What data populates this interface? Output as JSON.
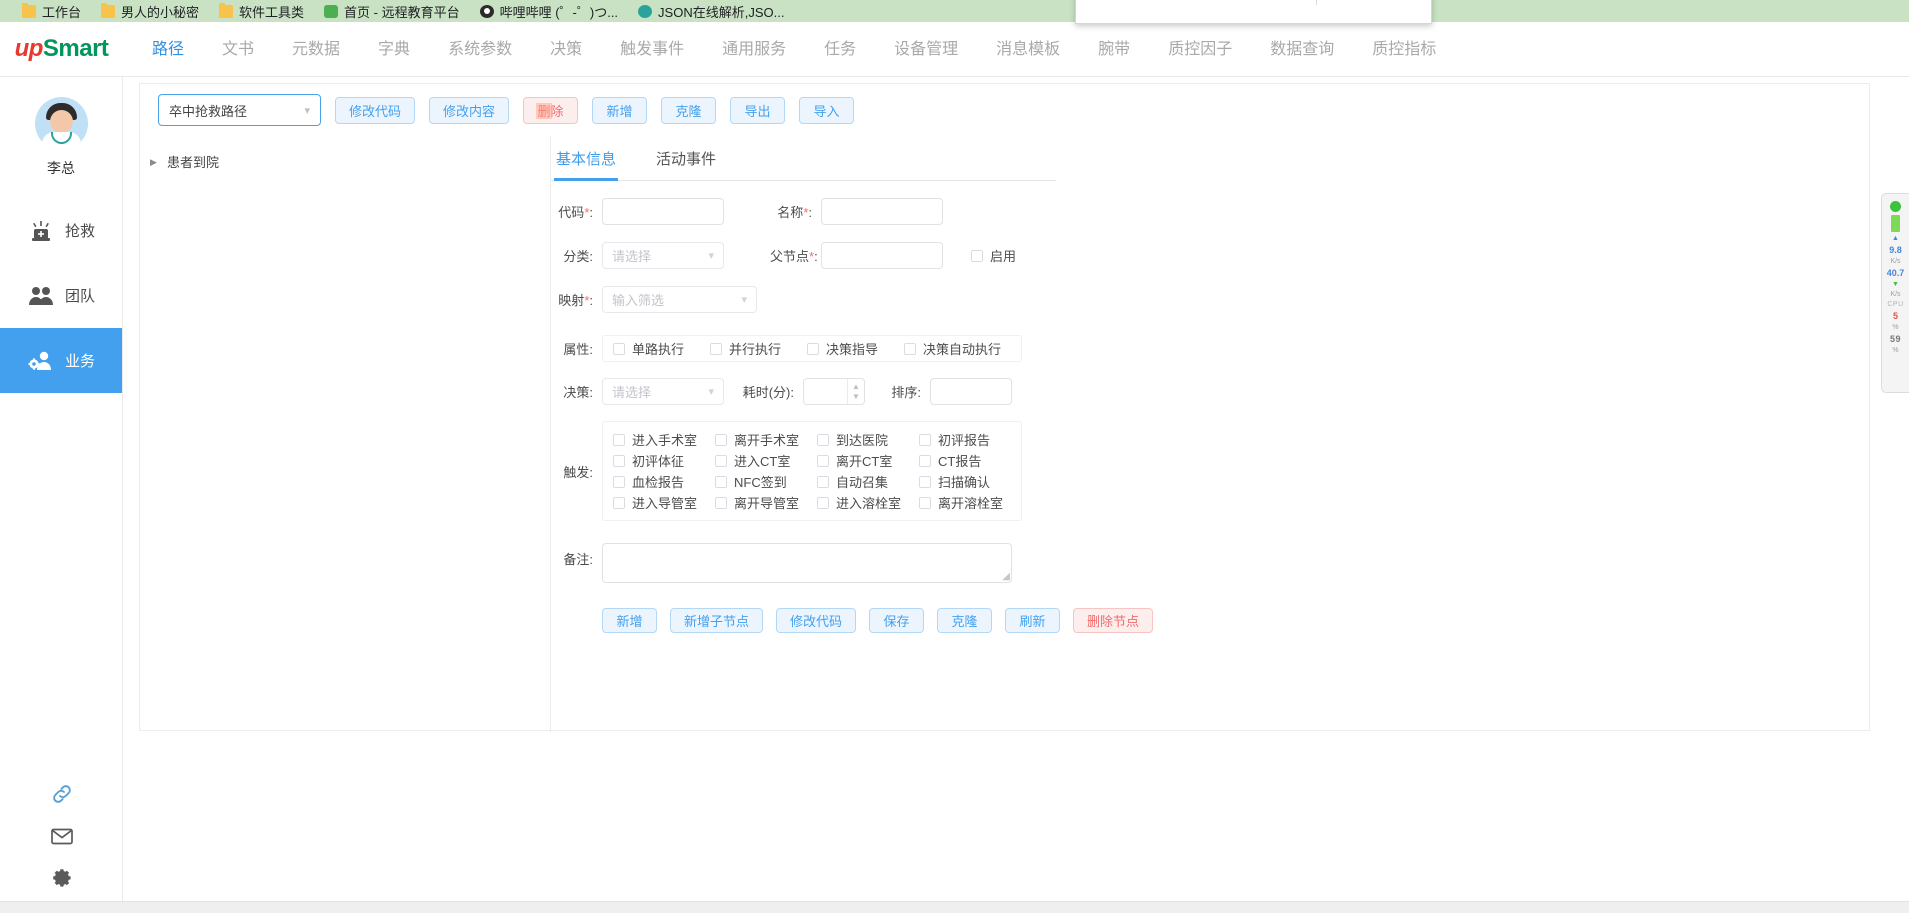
{
  "browser": {
    "bookmarks": [
      {
        "label": "工作台",
        "icon": "folder-icon"
      },
      {
        "label": "男人的小秘密",
        "icon": "folder-icon"
      },
      {
        "label": "软件工具类",
        "icon": "folder-icon"
      },
      {
        "label": "首页 - 远程教育平台",
        "icon": "green-site-icon"
      },
      {
        "label": "哔哩哔哩 (゜-゜)つ...",
        "icon": "bilibili-icon"
      },
      {
        "label": "JSON在线解析,JSO...",
        "icon": "json-site-icon"
      }
    ],
    "find_bar": {
      "value": "",
      "placeholder": "",
      "prev_label": "∧",
      "next_label": "∨",
      "close_label": "✕"
    }
  },
  "header": {
    "logo_up": "up",
    "logo_smart": "Smart",
    "nav": [
      {
        "label": "路径",
        "active": true
      },
      {
        "label": "文书",
        "active": false
      },
      {
        "label": "元数据",
        "active": false
      },
      {
        "label": "字典",
        "active": false
      },
      {
        "label": "系统参数",
        "active": false
      },
      {
        "label": "决策",
        "active": false
      },
      {
        "label": "触发事件",
        "active": false
      },
      {
        "label": "通用服务",
        "active": false
      },
      {
        "label": "任务",
        "active": false
      },
      {
        "label": "设备管理",
        "active": false
      },
      {
        "label": "消息模板",
        "active": false
      },
      {
        "label": "腕带",
        "active": false
      },
      {
        "label": "质控因子",
        "active": false
      },
      {
        "label": "数据查询",
        "active": false
      },
      {
        "label": "质控指标",
        "active": false
      }
    ]
  },
  "sidebar": {
    "user_name": "李总",
    "items": [
      {
        "label": "抢救",
        "icon": "alarm-icon",
        "active": false
      },
      {
        "label": "团队",
        "icon": "team-icon",
        "active": false
      },
      {
        "label": "业务",
        "icon": "business-gear-icon",
        "active": true
      }
    ],
    "bottom_icons": [
      {
        "icon": "link-icon"
      },
      {
        "icon": "mail-icon"
      },
      {
        "icon": "gear-icon"
      }
    ]
  },
  "toolbar": {
    "path_select_value": "卒中抢救路径",
    "buttons": [
      {
        "label": "修改代码",
        "style": "primary"
      },
      {
        "label": "修改内容",
        "style": "primary"
      },
      {
        "label": "删除",
        "style": "danger",
        "highlighted": true
      },
      {
        "label": "新增",
        "style": "primary"
      },
      {
        "label": "克隆",
        "style": "primary"
      },
      {
        "label": "导出",
        "style": "primary"
      },
      {
        "label": "导入",
        "style": "primary"
      }
    ]
  },
  "tree": {
    "nodes": [
      {
        "label": "患者到院",
        "caret": "▶"
      }
    ]
  },
  "tabs": [
    {
      "label": "基本信息",
      "active": true
    },
    {
      "label": "活动事件",
      "active": false
    }
  ],
  "form": {
    "code": {
      "label": "代码",
      "required": "*",
      "value": "",
      "placeholder": ""
    },
    "name": {
      "label": "名称",
      "required": "*",
      "value": "",
      "placeholder": ""
    },
    "category": {
      "label": "分类",
      "required": "",
      "value": "",
      "placeholder": "请选择"
    },
    "parent": {
      "label": "父节点",
      "required": "*",
      "value": "",
      "placeholder": ""
    },
    "enabled": {
      "label": "启用",
      "checked": false
    },
    "mapping": {
      "label": "映射",
      "required": "*",
      "value": "",
      "placeholder": "输入筛选"
    },
    "attributes": {
      "label": "属性",
      "options": [
        {
          "label": "单路执行",
          "checked": false
        },
        {
          "label": "并行执行",
          "checked": false
        },
        {
          "label": "决策指导",
          "checked": false
        },
        {
          "label": "决策自动执行",
          "checked": false
        }
      ]
    },
    "decision": {
      "label": "决策",
      "value": "",
      "placeholder": "请选择"
    },
    "duration": {
      "label": "耗时(分)",
      "value": "",
      "placeholder": ""
    },
    "sort": {
      "label": "排序",
      "value": "",
      "placeholder": ""
    },
    "triggers": {
      "label": "触发",
      "rows": [
        [
          {
            "label": "进入手术室",
            "checked": false
          },
          {
            "label": "离开手术室",
            "checked": false
          },
          {
            "label": "到达医院",
            "checked": false
          },
          {
            "label": "初评报告",
            "checked": false
          }
        ],
        [
          {
            "label": "初评体征",
            "checked": false
          },
          {
            "label": "进入CT室",
            "checked": false
          },
          {
            "label": "离开CT室",
            "checked": false
          },
          {
            "label": "CT报告",
            "checked": false
          }
        ],
        [
          {
            "label": "血检报告",
            "checked": false
          },
          {
            "label": "NFC签到",
            "checked": false
          },
          {
            "label": "自动召集",
            "checked": false
          },
          {
            "label": "扫描确认",
            "checked": false
          }
        ],
        [
          {
            "label": "进入导管室",
            "checked": false
          },
          {
            "label": "离开导管室",
            "checked": false
          },
          {
            "label": "进入溶栓室",
            "checked": false
          },
          {
            "label": "离开溶栓室",
            "checked": false
          }
        ]
      ]
    },
    "remark": {
      "label": "备注",
      "value": "",
      "placeholder": ""
    }
  },
  "form_buttons": [
    {
      "label": "新增",
      "style": "primary"
    },
    {
      "label": "新增子节点",
      "style": "primary"
    },
    {
      "label": "修改代码",
      "style": "primary"
    },
    {
      "label": "保存",
      "style": "primary"
    },
    {
      "label": "克隆",
      "style": "primary"
    },
    {
      "label": "刷新",
      "style": "primary"
    },
    {
      "label": "删除节点",
      "style": "danger"
    }
  ],
  "perf_widget": {
    "net_up_value": "9.8",
    "net_up_unit": "K/s",
    "net_down_value": "40.7",
    "net_down_unit": "K/s",
    "cpu_label": "CPU",
    "cpu_value": "5",
    "cpu_unit": "%",
    "mem_value": "59",
    "mem_unit": "%"
  },
  "colors": {
    "accent": "#42a0ef",
    "danger": "#f26b6b",
    "bookmark_bar": "#c9e2c4",
    "required": "#f56c6c"
  }
}
